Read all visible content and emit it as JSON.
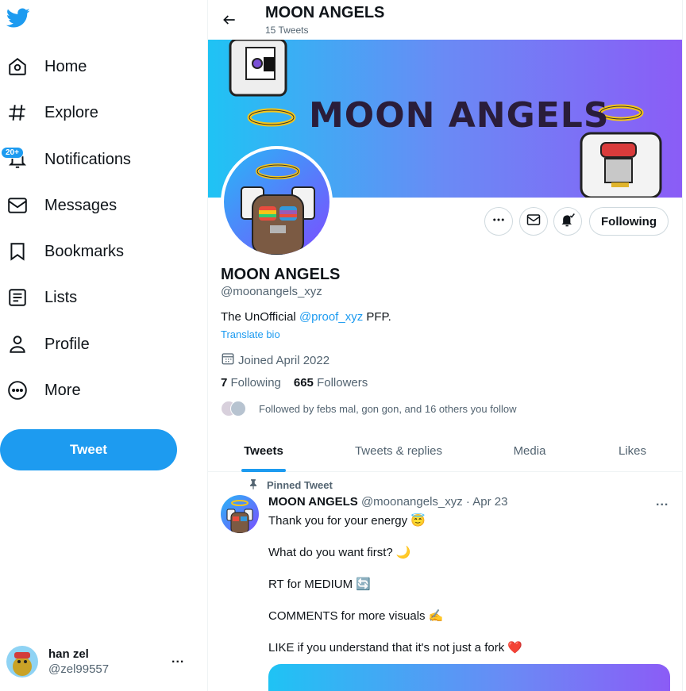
{
  "sidebar": {
    "logo": "twitter-bird-icon",
    "items": [
      {
        "label": "Home",
        "icon": "home-icon"
      },
      {
        "label": "Explore",
        "icon": "hashtag-icon"
      },
      {
        "label": "Notifications",
        "icon": "bell-icon",
        "badge": "20+"
      },
      {
        "label": "Messages",
        "icon": "envelope-icon"
      },
      {
        "label": "Bookmarks",
        "icon": "bookmark-icon"
      },
      {
        "label": "Lists",
        "icon": "list-icon"
      },
      {
        "label": "Profile",
        "icon": "person-icon"
      },
      {
        "label": "More",
        "icon": "more-circle-icon"
      }
    ],
    "tweet_button": "Tweet",
    "account": {
      "name": "han zel",
      "handle": "@zel99557",
      "more": "..."
    }
  },
  "header": {
    "title": "MOON ANGELS",
    "subtitle": "15 Tweets"
  },
  "banner": {
    "text": "MOON ANGELS"
  },
  "actions": {
    "following_label": "Following"
  },
  "profile": {
    "name": "MOON ANGELS",
    "handle": "@moonangels_xyz",
    "bio_prefix": "The UnOfficial ",
    "bio_link": "@proof_xyz",
    "bio_suffix": " PFP.",
    "translate": "Translate bio",
    "joined": "Joined April 2022",
    "following_count": "7",
    "following_label": " Following",
    "followers_count": "665",
    "followers_label": " Followers",
    "followed_by": "Followed by febs mal, gon gon, and 16 others you follow"
  },
  "tabs": [
    {
      "label": "Tweets",
      "active": true
    },
    {
      "label": "Tweets & replies",
      "active": false
    },
    {
      "label": "Media",
      "active": false
    },
    {
      "label": "Likes",
      "active": false
    }
  ],
  "pinned_tweet": {
    "pinned_label": "Pinned Tweet",
    "author": "MOON ANGELS",
    "handle_date": " @moonangels_xyz · Apr 23",
    "lines": [
      "Thank you for your energy 😇",
      "What do you want first? 🌙",
      "RT for MEDIUM 🔄",
      "COMMENTS for more visuals ✍",
      "LIKE if you understand that it's not just a fork   ❤️"
    ],
    "more": "..."
  },
  "colors": {
    "accent": "#1d9bf0",
    "text": "#0f1419",
    "muted": "#536471"
  }
}
